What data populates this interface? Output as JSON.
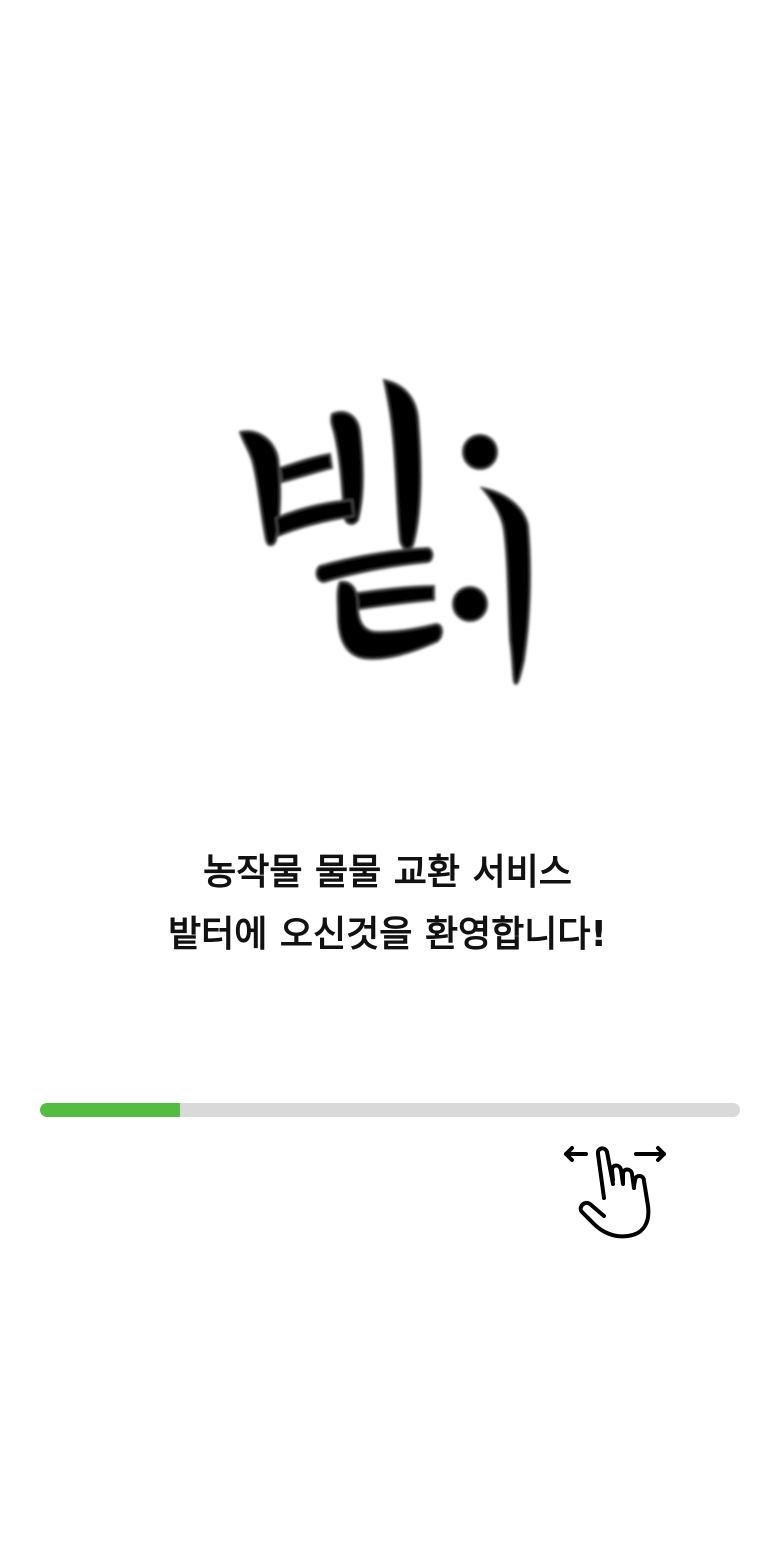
{
  "app": {
    "logo_text": "밭이",
    "logo_icon": "brush-calligraphy-logo"
  },
  "welcome": {
    "line1": "농작물 물물 교환 서비스",
    "line2": "밭터에 오신것을 환영합니다!"
  },
  "onboarding": {
    "progress_percent": 20,
    "progress_color": "#52bd40",
    "track_color": "#d9d9d9",
    "hint_icon": "swipe-horizontal-icon"
  }
}
